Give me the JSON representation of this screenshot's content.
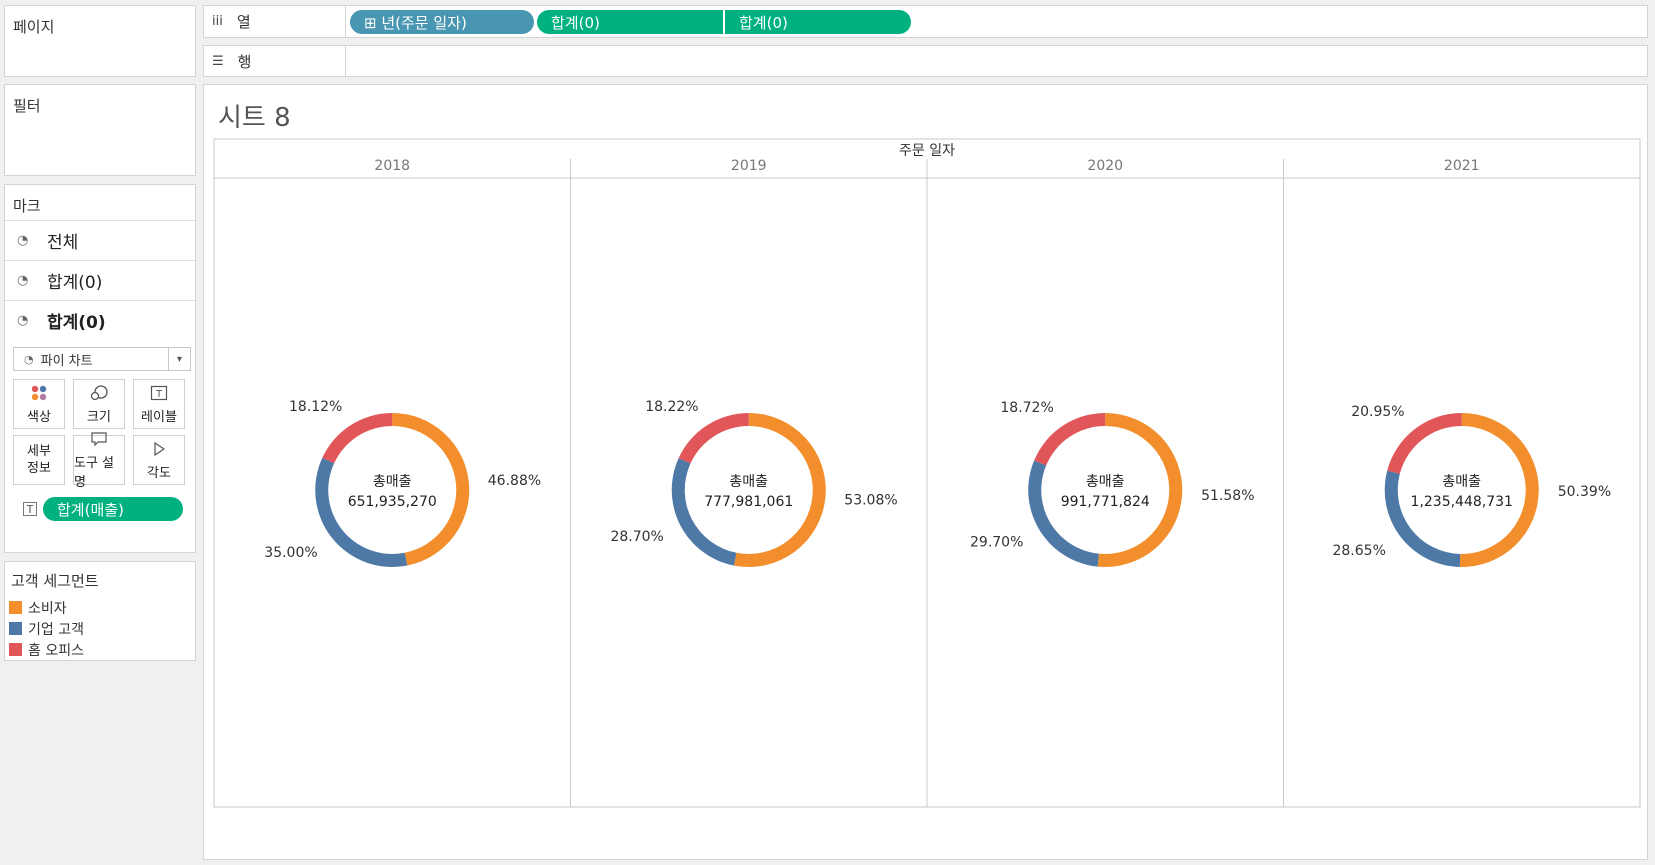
{
  "left": {
    "pages_title": "페이지",
    "filters_title": "필터",
    "marks_title": "마크",
    "mark_rows": [
      {
        "label": "전체",
        "icon": "pie-icon"
      },
      {
        "label": "합계(0)",
        "icon": "pie-icon"
      },
      {
        "label": "합계(0)",
        "icon": "pie-icon"
      }
    ],
    "mark_type": "파이 차트",
    "mark_buttons": [
      "색상",
      "크기",
      "레이블",
      "세부\n정보",
      "도구 설명",
      "각도"
    ],
    "mark_pill": "합계(매출)",
    "legend_title": "고객 세그먼트",
    "legend_items": [
      {
        "label": "소비자",
        "color": "#f28e2b"
      },
      {
        "label": "기업 고객",
        "color": "#4e79a7"
      },
      {
        "label": "홈 오피스",
        "color": "#e15759"
      }
    ]
  },
  "shelves": {
    "columns_label": "열",
    "rows_label": "행",
    "column_pills": [
      {
        "label": "⊞ 년(주문 일자)",
        "color": "#4996b2"
      },
      {
        "label": "합계(0)",
        "color": "#00b180"
      },
      {
        "label": "합계(0)",
        "color": "#00b180"
      }
    ]
  },
  "view": {
    "title": "시트 8"
  },
  "chart_data": {
    "type": "pie",
    "subtype": "donut",
    "header": "주문 일자",
    "center_label": "총매출",
    "segments": [
      "소비자",
      "기업 고객",
      "홈 오피스"
    ],
    "colors": [
      "#f28e2b",
      "#4e79a7",
      "#e15759"
    ],
    "years": [
      {
        "year": "2018",
        "total": "651,935,270",
        "values": [
          46.88,
          35.0,
          18.12
        ],
        "labels": [
          "46.88%",
          "35.00%",
          "18.12%"
        ]
      },
      {
        "year": "2019",
        "total": "777,981,061",
        "values": [
          53.08,
          28.7,
          18.22
        ],
        "labels": [
          "53.08%",
          "28.70%",
          "18.22%"
        ]
      },
      {
        "year": "2020",
        "total": "991,771,824",
        "values": [
          51.58,
          29.7,
          18.72
        ],
        "labels": [
          "51.58%",
          "29.70%",
          "18.72%"
        ]
      },
      {
        "year": "2021",
        "total": "1,235,448,731",
        "values": [
          50.39,
          28.65,
          20.95
        ],
        "labels": [
          "50.39%",
          "28.65%",
          "20.95%"
        ]
      }
    ]
  }
}
